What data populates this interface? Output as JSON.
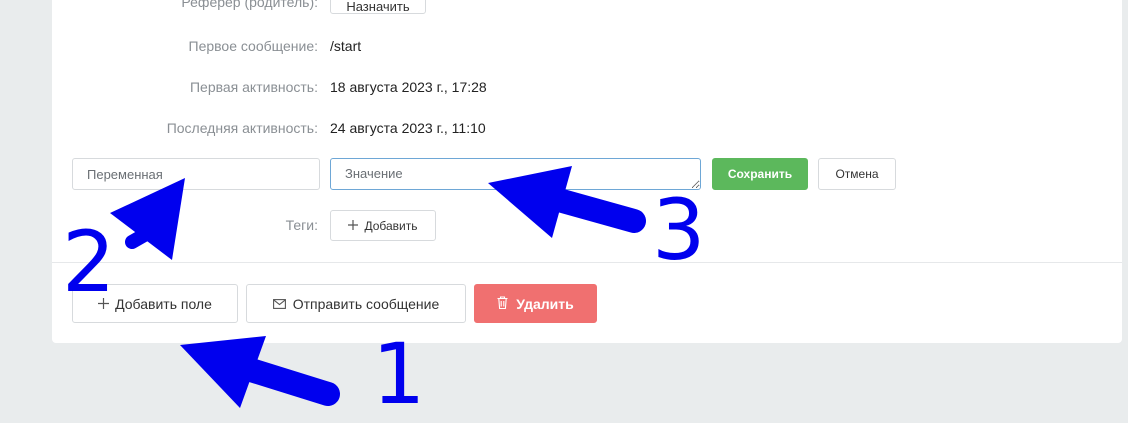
{
  "profile": {
    "referrer_label": "Реферер (родитель):",
    "referrer_button": "Назначить",
    "first_message_label": "Первое сообщение:",
    "first_message_value": "/start",
    "first_activity_label": "Первая активность:",
    "first_activity_value": "18 августа 2023 г., 17:28",
    "last_activity_label": "Последняя активность:",
    "last_activity_value": "24 августа 2023 г., 11:10"
  },
  "field_editor": {
    "variable_placeholder": "Переменная",
    "value_placeholder": "Значение",
    "save_label": "Сохранить",
    "cancel_label": "Отмена"
  },
  "tags": {
    "label": "Теги:",
    "add_label": "Добавить"
  },
  "actions": {
    "add_field_label": "Добавить поле",
    "send_message_label": "Отправить сообщение",
    "delete_label": "Удалить"
  },
  "annotations": {
    "marker_1": "1",
    "marker_2": "2",
    "marker_3": "3"
  },
  "colors": {
    "save": "#5cb85c",
    "delete": "#f07070",
    "annotation": "#0000ee",
    "focus_border": "#6ea7d6"
  },
  "icons": {
    "add_field": "plus-icon",
    "send_message": "envelope-icon",
    "delete": "trash-icon",
    "add_tag": "plus-icon"
  }
}
